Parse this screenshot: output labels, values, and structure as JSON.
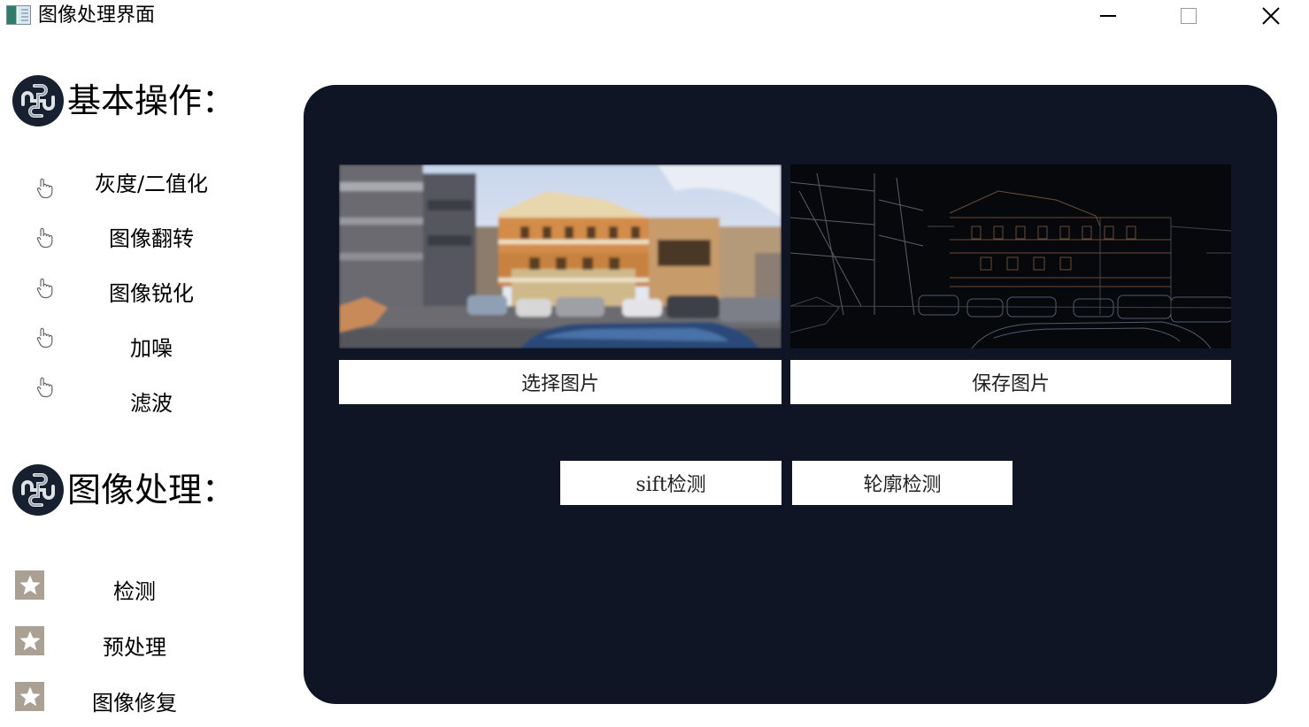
{
  "window": {
    "title": "图像处理界面",
    "icon": "app-window-icon"
  },
  "basic_section": {
    "title": "基本操作：",
    "icon": "puzzle-logo-icon",
    "items": [
      {
        "label": "灰度/二值化",
        "icon": "pointing-hand-icon"
      },
      {
        "label": "图像翻转",
        "icon": "pointing-hand-icon"
      },
      {
        "label": "图像锐化",
        "icon": "pointing-hand-icon"
      },
      {
        "label": "加噪",
        "icon": "pointing-hand-icon"
      },
      {
        "label": "滤波",
        "icon": "pointing-hand-icon"
      }
    ]
  },
  "process_section": {
    "title": "图像处理：",
    "icon": "puzzle-logo-icon",
    "items": [
      {
        "label": "检测",
        "icon": "star-icon"
      },
      {
        "label": "预处理",
        "icon": "star-icon"
      },
      {
        "label": "图像修复",
        "icon": "star-icon"
      }
    ]
  },
  "main": {
    "source_image": "street-photo-original",
    "result_image": "street-photo-edge-detected",
    "select_button": "选择图片",
    "save_button": "保存图片",
    "sift_button": "sift检测",
    "contour_button": "轮廓检测"
  },
  "colors": {
    "panel_bg": "#0f1524",
    "button_bg": "#ffffff",
    "star_bg": "#aaa094"
  }
}
